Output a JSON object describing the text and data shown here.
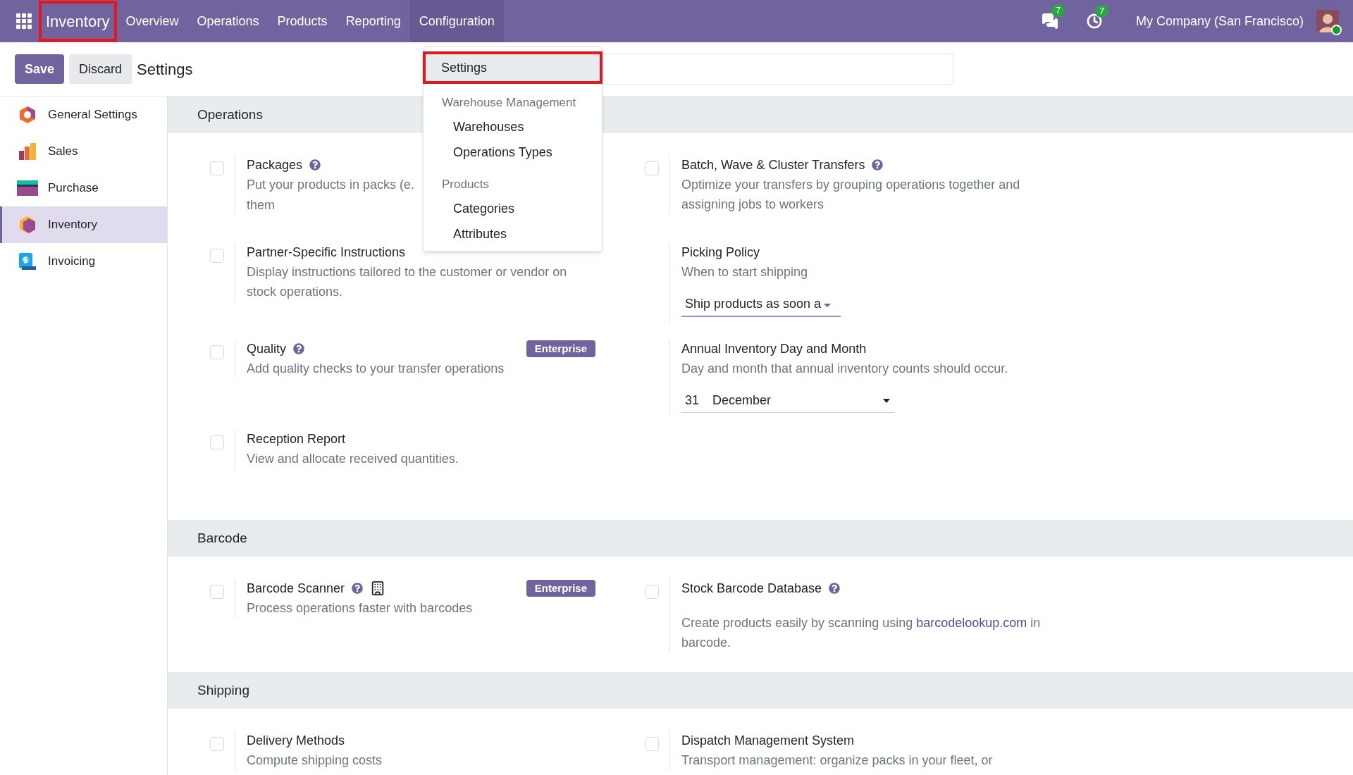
{
  "navbar": {
    "app": {
      "label": "Inventory",
      "highlighted": true
    },
    "menu": [
      {
        "label": "Overview",
        "selected": false
      },
      {
        "label": "Operations",
        "selected": false
      },
      {
        "label": "Products",
        "selected": false
      },
      {
        "label": "Reporting",
        "selected": false
      },
      {
        "label": "Configuration",
        "selected": true
      }
    ],
    "messages_count": "7",
    "activities_count": "7",
    "company": "My Company (San Francisco)",
    "user_online": true
  },
  "control_bar": {
    "buttons": [
      {
        "label": "Save",
        "kind": "primary"
      },
      {
        "label": "Discard",
        "kind": "secondary"
      }
    ],
    "title": "Settings"
  },
  "dropdown": [
    {
      "kind": "item",
      "label": "Settings",
      "highlighted": true,
      "selected": true
    },
    {
      "kind": "header",
      "label": "Warehouse Management"
    },
    {
      "kind": "item",
      "label": "Warehouses",
      "highlighted": false,
      "selected": false
    },
    {
      "kind": "item",
      "label": "Operations Types",
      "highlighted": false,
      "selected": false
    },
    {
      "kind": "header",
      "label": "Products"
    },
    {
      "kind": "item",
      "label": "Categories",
      "highlighted": false,
      "selected": false
    },
    {
      "kind": "item",
      "label": "Attributes",
      "highlighted": false,
      "selected": false
    }
  ],
  "sidebar": {
    "items": [
      {
        "label": "General Settings",
        "selected": false
      },
      {
        "label": "Sales",
        "selected": false
      },
      {
        "label": "Purchase",
        "selected": false
      },
      {
        "label": "Inventory",
        "selected": true
      },
      {
        "label": "Invoicing",
        "selected": false
      }
    ]
  },
  "sections": [
    {
      "title": "Operations",
      "settings": [
        {
          "kind": "toggle",
          "title": "Packages",
          "checked": false,
          "help": true,
          "description": [
            "Put your products in packs (e.",
            "them"
          ]
        },
        {
          "kind": "toggle",
          "title": "Batch, Wave & Cluster Transfers",
          "checked": false,
          "help": true,
          "description": [
            "Optimize your transfers by grouping operations together and assigning jobs to workers"
          ]
        },
        {
          "kind": "toggle",
          "title": "Partner-Specific Instructions",
          "checked": false,
          "help": false,
          "description": [
            "Display instructions tailored to the customer or vendor on stock operations."
          ]
        },
        {
          "kind": "plain",
          "title": "Picking Policy",
          "help": false,
          "description": [
            "When to start shipping"
          ],
          "select": {
            "kind": "single",
            "value": "Ship products as soon a"
          }
        },
        {
          "kind": "toggle",
          "title": "Quality",
          "checked": false,
          "help": true,
          "badge": "Enterprise",
          "description": [
            "Add quality checks to your transfer operations"
          ]
        },
        {
          "kind": "plain",
          "title": "Annual Inventory Day and Month",
          "help": false,
          "description": [
            "Day and month that annual inventory counts should occur."
          ],
          "select": {
            "kind": "date",
            "day": "31",
            "value": "December"
          }
        },
        {
          "kind": "toggle",
          "title": "Reception Report",
          "checked": false,
          "help": false,
          "description": [
            "View and allocate received quantities."
          ]
        }
      ]
    },
    {
      "title": "Barcode",
      "settings": [
        {
          "kind": "toggle",
          "title": "Barcode Scanner",
          "checked": false,
          "help": true,
          "building": true,
          "badge": "Enterprise",
          "description": [
            "Process operations faster with barcodes"
          ]
        },
        {
          "kind": "toggle",
          "title": "Stock Barcode Database",
          "checked": false,
          "help": true,
          "description": [
            "Create products easily by scanning using"
          ],
          "link": "barcodelookup.com",
          "after_link": "in barcode."
        }
      ]
    },
    {
      "title": "Shipping",
      "settings": [
        {
          "kind": "toggle",
          "title": "Delivery Methods",
          "checked": false,
          "help": false,
          "description": [
            "Compute shipping costs"
          ]
        },
        {
          "kind": "toggle",
          "title": "Dispatch Management System",
          "checked": false,
          "help": false,
          "description": [
            "Transport management: organize packs in your fleet, or"
          ]
        }
      ]
    }
  ]
}
